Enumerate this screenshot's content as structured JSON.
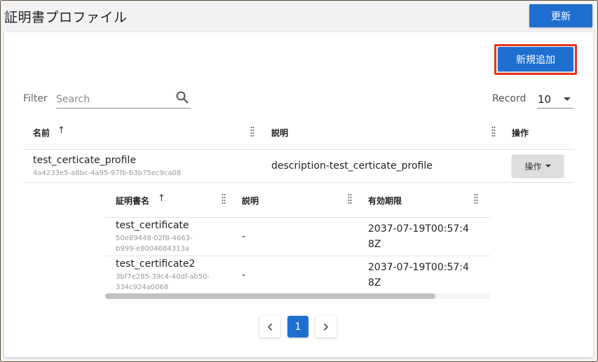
{
  "header": {
    "title": "証明書プロファイル",
    "refresh_label": "更新"
  },
  "toolbar": {
    "add_label": "新規追加",
    "filter_label": "Filter",
    "search_placeholder": "Search",
    "record_label": "Record",
    "record_value": "10"
  },
  "table": {
    "columns": [
      "名前",
      "説明",
      "操作"
    ],
    "rows": [
      {
        "name": "test_certicate_profile",
        "id": "4a4233e5-a8bc-4a95-97fb-b3b75ec9ca08",
        "description": "description-test_certicate_profile",
        "action_label": "操作"
      }
    ]
  },
  "subtable": {
    "columns": [
      "証明書名",
      "説明",
      "有効期限"
    ],
    "rows": [
      {
        "name": "test_certificate",
        "id_line1": "50e89448-02f8-4663-",
        "id_line2": "b999-e8004684313a",
        "description": "-",
        "expiry_line1": "2037-07-19T00:57:4",
        "expiry_line2": "8Z"
      },
      {
        "name": "test_certificate2",
        "id_line1": "3bf7e285-39c4-40df-ab50-",
        "id_line2": "334c924a0068",
        "description": "-",
        "expiry_line1": "2037-07-19T00:57:4",
        "expiry_line2": "8Z"
      }
    ]
  },
  "pagination": {
    "prev_icon": "chevron-left-icon",
    "current_page": "1",
    "next_icon": "chevron-right-icon"
  },
  "colors": {
    "primary": "#1f6fd1",
    "highlight": "#e8341a"
  }
}
